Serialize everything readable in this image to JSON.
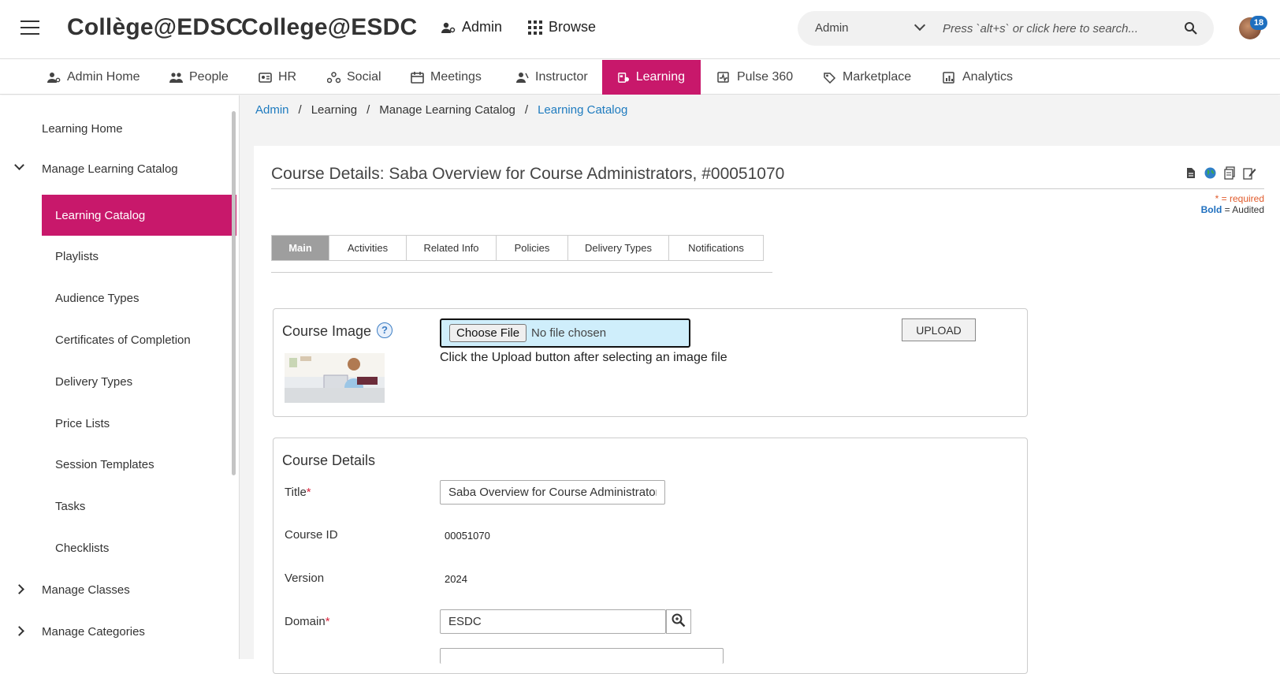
{
  "header": {
    "brand_fr": "Collège@EDSC",
    "brand_en": "College@ESDC",
    "admin_label": "Admin",
    "browse_label": "Browse",
    "search": {
      "scope_value": "Admin",
      "placeholder": "Press `alt+s` or click here to search..."
    },
    "notification_count": "18"
  },
  "tabs": [
    {
      "label": "Admin Home",
      "icon": "admin-home-icon"
    },
    {
      "label": "People",
      "icon": "people-icon"
    },
    {
      "label": "HR",
      "icon": "hr-icon"
    },
    {
      "label": "Social",
      "icon": "social-icon"
    },
    {
      "label": "Meetings",
      "icon": "meetings-icon"
    },
    {
      "label": "Instructor",
      "icon": "instructor-icon"
    },
    {
      "label": "Learning",
      "icon": "learning-icon",
      "active": true
    },
    {
      "label": "Pulse 360",
      "icon": "pulse-icon"
    },
    {
      "label": "Marketplace",
      "icon": "marketplace-icon"
    },
    {
      "label": "Analytics",
      "icon": "analytics-icon"
    }
  ],
  "sidebar": {
    "items": [
      {
        "label": "Learning Home"
      },
      {
        "label": "Manage Learning Catalog",
        "expanded": true
      },
      {
        "label": "Learning Catalog",
        "active": true
      },
      {
        "label": "Playlists"
      },
      {
        "label": "Audience Types"
      },
      {
        "label": "Certificates of Completion"
      },
      {
        "label": "Delivery Types"
      },
      {
        "label": "Price Lists"
      },
      {
        "label": "Session Templates"
      },
      {
        "label": "Tasks"
      },
      {
        "label": "Checklists"
      },
      {
        "label": "Manage Classes",
        "expanded": false
      },
      {
        "label": "Manage Categories",
        "expanded": false
      }
    ]
  },
  "breadcrumb": {
    "items": [
      "Admin",
      "Learning",
      "Manage Learning Catalog",
      "Learning Catalog"
    ],
    "separator": "/"
  },
  "course": {
    "title": "Course Details: Saba Overview for Course Administrators, #00051070",
    "legend_required": "* = required",
    "legend_bold": "Bold",
    "legend_audited": " = Audited",
    "tabs": [
      "Main",
      "Activities",
      "Related Info",
      "Policies",
      "Delivery Types",
      "Notifications"
    ],
    "active_tab": "Main",
    "image_section": {
      "heading": "Course Image",
      "choose_label": "Choose File",
      "file_status": "No file chosen",
      "hint": "Click the Upload button after selecting an image file",
      "upload_label": "UPLOAD"
    },
    "details_section": {
      "heading": "Course Details",
      "title_label": "Title",
      "title_value": "Saba Overview for Course Administrators",
      "course_id_label": "Course ID",
      "course_id_value": "00051070",
      "version_label": "Version",
      "version_value": "2024",
      "domain_label": "Domain",
      "domain_value": "ESDC"
    }
  },
  "colors": {
    "accent": "#c8186b",
    "link": "#1e7bbf",
    "required": "#d9263e"
  }
}
